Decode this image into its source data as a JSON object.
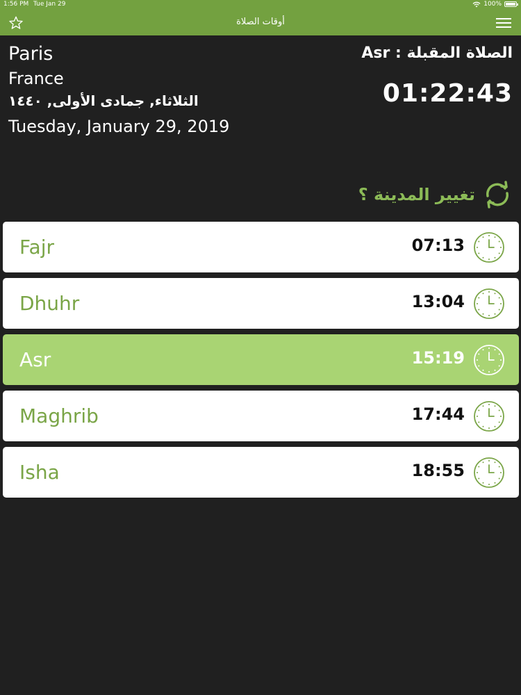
{
  "status_bar": {
    "time": "1:56 PM",
    "date": "Tue Jan 29",
    "battery": "100%"
  },
  "nav": {
    "title": "أوقات الصلاة"
  },
  "location": {
    "city": "Paris",
    "country": "France"
  },
  "hijri_date": "الثلاثاء, جمادى الأولى, ١٤٤٠",
  "gregorian_date": "Tuesday, January 29, 2019",
  "next_prayer": {
    "label": "الصلاة المقبلة : Asr",
    "countdown": "01:22:43"
  },
  "change_city": {
    "label": "تغيير المدينة ؟"
  },
  "prayers": [
    {
      "name": "Fajr",
      "time": "07:13"
    },
    {
      "name": "Dhuhr",
      "time": "13:04"
    },
    {
      "name": "Asr",
      "time": "15:19",
      "active": true
    },
    {
      "name": "Maghrib",
      "time": "17:44"
    },
    {
      "name": "Isha",
      "time": "18:55"
    }
  ],
  "colors": {
    "accent": "#73a140",
    "active_row": "#a9d473",
    "background": "#202020"
  }
}
